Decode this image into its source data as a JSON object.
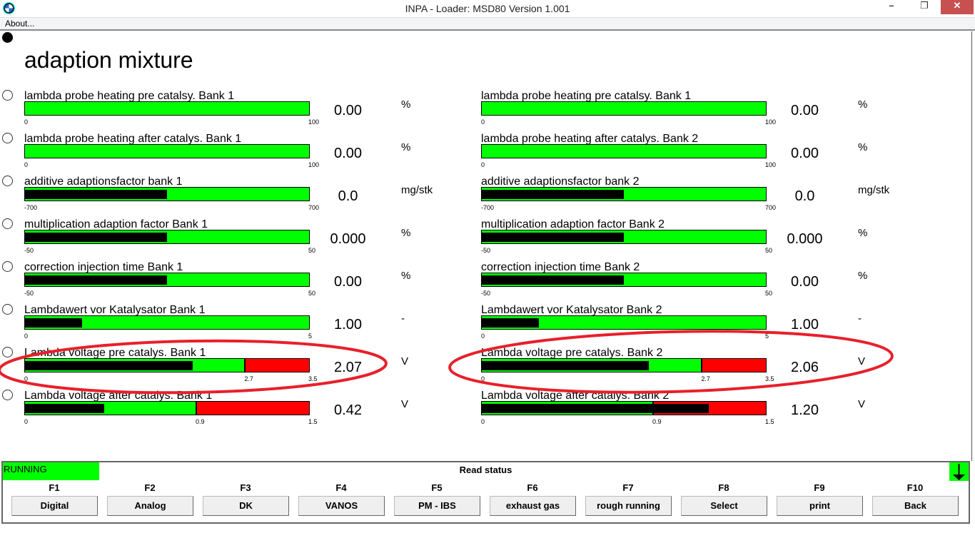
{
  "window": {
    "title": "INPA - Loader:  MSD80 Version 1.001",
    "minimize": "–",
    "restore": "❐",
    "close": "✕"
  },
  "menu": {
    "about": "About..."
  },
  "page": {
    "heading": "adaption mixture"
  },
  "colors": {
    "ok": "#00ff00",
    "alarm": "#ff0000",
    "indicator": "#000000",
    "annotation": "#e8202a"
  },
  "gauges_left": [
    {
      "label": "lambda probe heating pre catalsy. Bank 1",
      "min": "0",
      "max": "100",
      "threshold": null,
      "value": "0.00",
      "unit": "%",
      "fill": 0,
      "from_center": false
    },
    {
      "label": "lambda probe heating after catalys. Bank 1",
      "min": "0",
      "max": "100",
      "threshold": null,
      "value": "0.00",
      "unit": "%",
      "fill": 0,
      "from_center": false
    },
    {
      "label": "additive adaptionsfactor bank 1",
      "min": "-700",
      "max": "700",
      "threshold": null,
      "value": "0.0",
      "unit": "mg/stk",
      "fill": 0.5,
      "from_center": false
    },
    {
      "label": "multiplication adaption factor Bank 1",
      "min": "-50",
      "max": "50",
      "threshold": null,
      "value": "0.000",
      "unit": "%",
      "fill": 0.5,
      "from_center": false
    },
    {
      "label": "correction injection time Bank 1",
      "min": "-50",
      "max": "50",
      "threshold": null,
      "value": "0.00",
      "unit": "%",
      "fill": 0.5,
      "from_center": false
    },
    {
      "label": "Lambdawert vor Katalysator Bank 1",
      "min": "0",
      "max": "5",
      "threshold": null,
      "value": "1.00",
      "unit": "-",
      "fill": 0.2,
      "from_center": false
    },
    {
      "label": "Lambda voltage pre catalys. Bank 1",
      "min": "0",
      "max": "3.5",
      "threshold": "2.7",
      "value": "2.07",
      "unit": "V",
      "fill": 0.591,
      "tfrac": 0.771
    },
    {
      "label": "Lambda voltage after catalys. Bank 1",
      "min": "0",
      "max": "1.5",
      "threshold": "0.9",
      "value": "0.42",
      "unit": "V",
      "fill": 0.28,
      "tfrac": 0.6
    }
  ],
  "gauges_right": [
    {
      "label": "lambda probe heating pre catalsy. Bank 1",
      "min": "0",
      "max": "100",
      "threshold": null,
      "value": "0.00",
      "unit": "%",
      "fill": 0
    },
    {
      "label": "lambda probe heating after catalys. Bank 2",
      "min": "0",
      "max": "100",
      "threshold": null,
      "value": "0.00",
      "unit": "%",
      "fill": 0
    },
    {
      "label": "additive adaptionsfactor bank 2",
      "min": "-700",
      "max": "700",
      "threshold": null,
      "value": "0.0",
      "unit": "mg/stk",
      "fill": 0.5
    },
    {
      "label": "multiplication adaption factor Bank 2",
      "min": "-50",
      "max": "50",
      "threshold": null,
      "value": "0.000",
      "unit": "%",
      "fill": 0.5
    },
    {
      "label": "correction injection time Bank 2",
      "min": "-50",
      "max": "50",
      "threshold": null,
      "value": "0.00",
      "unit": "%",
      "fill": 0.5
    },
    {
      "label": "Lambdawert vor Katalysator Bank 2",
      "min": "0",
      "max": "5",
      "threshold": null,
      "value": "1.00",
      "unit": "-",
      "fill": 0.2
    },
    {
      "label": "Lambda voltage pre catalys. Bank 2",
      "min": "0",
      "max": "3.5",
      "threshold": "2.7",
      "value": "2.06",
      "unit": "V",
      "fill": 0.589,
      "tfrac": 0.771
    },
    {
      "label": "Lambda voltage after catalys. Bank 2",
      "min": "0",
      "max": "1.5",
      "threshold": "0.9",
      "value": "1.20",
      "unit": "V",
      "fill": 0.8,
      "tfrac": 0.6
    }
  ],
  "status": {
    "state": "RUNNING",
    "message": "Read status",
    "arrow": "down-arrow-icon"
  },
  "fkeys": [
    {
      "key": "F1",
      "label": "Digital"
    },
    {
      "key": "F2",
      "label": "Analog"
    },
    {
      "key": "F3",
      "label": "DK"
    },
    {
      "key": "F4",
      "label": "VANOS"
    },
    {
      "key": "F5",
      "label": "PM - IBS"
    },
    {
      "key": "F6",
      "label": "exhaust gas"
    },
    {
      "key": "F7",
      "label": "rough running"
    },
    {
      "key": "F8",
      "label": "Select"
    },
    {
      "key": "F9",
      "label": "print"
    },
    {
      "key": "F10",
      "label": "Back"
    }
  ]
}
